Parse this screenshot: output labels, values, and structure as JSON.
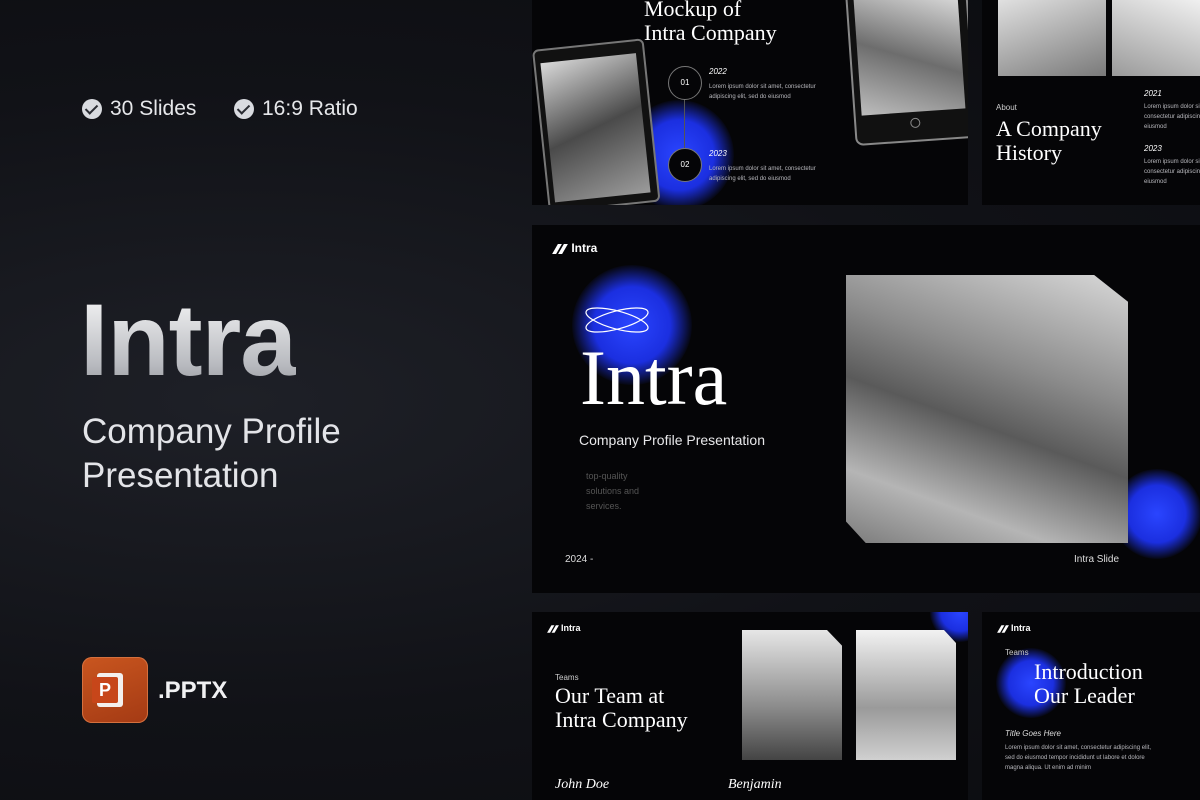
{
  "badges": [
    "30 Slides",
    "16:9 Ratio"
  ],
  "brand": {
    "title": "Intra",
    "subtitle_line1": "Company Profile",
    "subtitle_line2": "Presentation",
    "file_ext": ".PPTX",
    "app_icon": "powerpoint-icon",
    "accent": "#1f36ff"
  },
  "slide_mockup": {
    "title_line1": "Mockup of",
    "title_line2": "Intra Company",
    "step1_num": "01",
    "step1_year": "2022",
    "step2_num": "02",
    "step2_year": "2023",
    "body": "Lorem ipsum dolor sit amet, consectetur adipiscing elit, sed do eiusmod"
  },
  "slide_history": {
    "label": "About",
    "title_line1": "A Company",
    "title_line2": "History",
    "year1": "2021",
    "year2": "2023",
    "body_line1": "Lorem ipsum dolor sit amet,",
    "body_line2": "consectetur adipiscing elit, sed do",
    "body_line3": "eiusmod"
  },
  "slide_main": {
    "logo": "Intra",
    "title": "Intra",
    "subtitle": "Company Profile Presentation",
    "tag_line1": "top-quality",
    "tag_line2": "solutions and",
    "tag_line3": "services.",
    "year": "2024 -",
    "footer": "Intra Slide"
  },
  "slide_team": {
    "logo": "Intra",
    "label": "Teams",
    "title_line1": "Our Team at",
    "title_line2": "Intra Company",
    "name1": "John Doe",
    "name2": "Benjamin"
  },
  "slide_leader": {
    "logo": "Intra",
    "label": "Teams",
    "title_line1": "Introduction",
    "title_line2": "Our Leader",
    "sub": "Title Goes Here",
    "body_line1": "Lorem ipsum dolor sit amet, consectetur adipiscing elit,",
    "body_line2": "sed do eiusmod tempor incididunt ut labore et dolore",
    "body_line3": "magna aliqua. Ut enim ad minim"
  }
}
